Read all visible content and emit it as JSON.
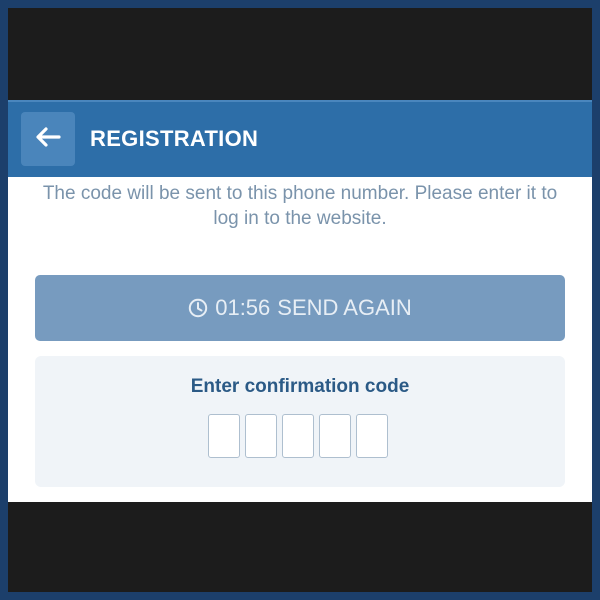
{
  "header": {
    "title": "REGISTRATION",
    "back_icon": "arrow-left-icon"
  },
  "info": {
    "text": "The code will be sent to this phone number. Please enter it to log in to the website."
  },
  "send_again": {
    "timer": "01:56",
    "label": "SEND AGAIN",
    "icon": "clock-icon"
  },
  "confirmation": {
    "label": "Enter confirmation code",
    "digits": 5
  },
  "colors": {
    "header_bg": "#2d6ea8",
    "button_bg": "#779bbf",
    "label_color": "#2b5a86"
  }
}
